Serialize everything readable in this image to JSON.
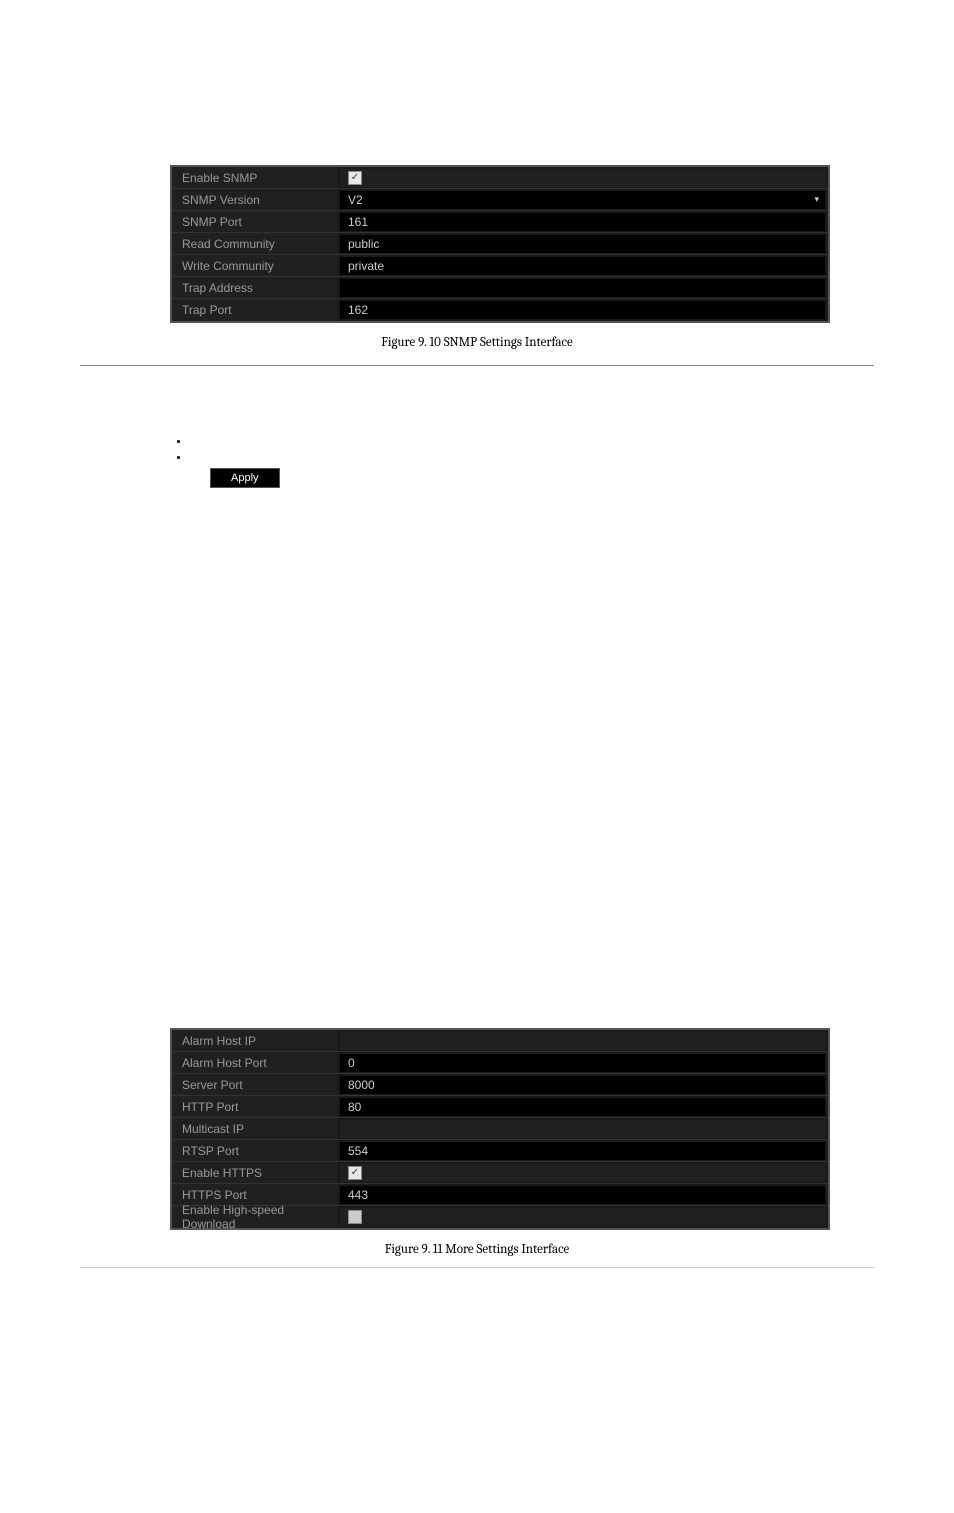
{
  "snmp": {
    "rows": [
      {
        "label": "Enable SNMP",
        "value": "",
        "checkbox": true,
        "checked": true
      },
      {
        "label": "SNMP Version",
        "value": "V2",
        "dropdown": true
      },
      {
        "label": "SNMP Port",
        "value": "161"
      },
      {
        "label": "Read Community",
        "value": "public"
      },
      {
        "label": "Write Community",
        "value": "private"
      },
      {
        "label": "Trap Address",
        "value": ""
      },
      {
        "label": "Trap Port",
        "value": "162"
      }
    ],
    "caption": "Figure 9. 10  SNMP Settings Interface"
  },
  "apply_label": "Apply",
  "more": {
    "rows": [
      {
        "label": "Alarm Host IP",
        "value": "",
        "blank": true
      },
      {
        "label": "Alarm Host Port",
        "value": "0"
      },
      {
        "label": "Server Port",
        "value": "8000"
      },
      {
        "label": "HTTP Port",
        "value": "80"
      },
      {
        "label": "Multicast IP",
        "value": "",
        "blank": true
      },
      {
        "label": "RTSP Port",
        "value": "554"
      },
      {
        "label": "Enable HTTPS",
        "value": "",
        "checkbox": true,
        "checked": true
      },
      {
        "label": "HTTPS Port",
        "value": "443"
      },
      {
        "label": "Enable High-speed Download",
        "value": "",
        "checkbox": true,
        "checked": false
      }
    ],
    "caption": "Figure 9. 11  More Settings Interface"
  }
}
